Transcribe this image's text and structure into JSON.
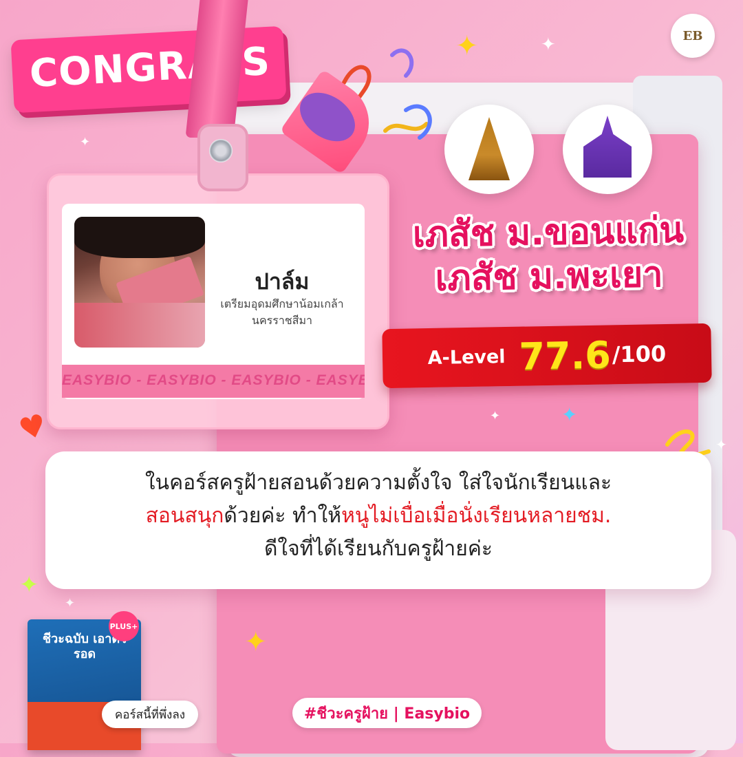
{
  "banner": {
    "congrats": "CONGRATS"
  },
  "brand": {
    "logo_text": "EB"
  },
  "student": {
    "name": "ปาล์ม",
    "school_line1": "เตรียมอุดมศึกษาน้อมเกล้า",
    "school_line2": "นครราชสีมา",
    "photo_label": "student-photo"
  },
  "card_stripe": "EASYBIO - EASYBIO - EASYBIO - EASYBIO - EASYBIO",
  "admission": {
    "line1": "เภสัช ม.ขอนแก่น",
    "line2": "เภสัช ม.พะเยา"
  },
  "score": {
    "label": "A-Level",
    "value": "77.6",
    "max": "/100"
  },
  "quote": {
    "part1": "ในคอร์สครูฝ้ายสอนด้วยความตั้งใจ ใส่ใจนักเรียนและ",
    "part2_red": "สอนสนุก",
    "part3": "ด้วยค่ะ ทำให้",
    "part4_red": "หนูไม่เบื่อเมื่อนั่งเรียนหลายชม.",
    "part5": "ดีใจที่ได้เรียนกับครูฝ้ายค่ะ"
  },
  "product": {
    "title": "ชีวะฉบับ เอาตัวรอด",
    "badge": "PLUS+",
    "new_tag": "คอร์สนี้ที่พึ่งลง"
  },
  "hashtag": "#ชีวะครูฝ้าย | Easybio",
  "colors": {
    "accent_pink": "#e5115f",
    "score_red": "#e31b23",
    "score_yellow": "#ffe51a"
  }
}
